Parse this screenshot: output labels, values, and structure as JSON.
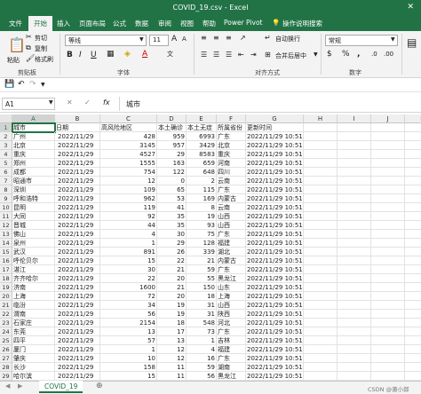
{
  "title": "COVID_19.csv - Excel",
  "tabs": [
    "文件",
    "开始",
    "插入",
    "页面布局",
    "公式",
    "数据",
    "审阅",
    "视图",
    "帮助",
    "Power Pivot",
    "操作说明搜索"
  ],
  "ribbon": {
    "paste": "粘贴",
    "cut": "剪切",
    "copy": "复制",
    "format_painter": "格式刷",
    "clipboard": "剪贴板",
    "font_name": "等线",
    "font_size": "11",
    "font_group": "字体",
    "wrap": "自动换行",
    "merge": "合并后居中",
    "align_group": "对齐方式",
    "number_format": "常规",
    "number_group": "数字",
    "bold": "B",
    "italic": "I",
    "underline": "U",
    "increase_font": "A",
    "decrease_font": "A",
    "font_color": "A",
    "percent": "%",
    "comma": ",",
    "currency": "$"
  },
  "formula": {
    "cell_ref": "A1",
    "value": "城市",
    "fx": "fx",
    "cancel": "✕",
    "enter": "✓"
  },
  "columns": [
    "A",
    "B",
    "C",
    "D",
    "E",
    "F",
    "G",
    "H",
    "I",
    "J",
    "K"
  ],
  "rows": [
    [
      "城市",
      "日期",
      "高风险地区",
      "本土确诊",
      "本土无症",
      "所属省份",
      "更新时间"
    ],
    [
      "广州",
      "2022/11/29",
      "428",
      "959",
      "6993",
      "广东",
      "2022/11/29 10:51"
    ],
    [
      "北京",
      "2022/11/29",
      "3145",
      "957",
      "3429",
      "北京",
      "2022/11/29 10:51"
    ],
    [
      "重庆",
      "2022/11/29",
      "4527",
      "29",
      "8583",
      "重庆",
      "2022/11/29 10:51"
    ],
    [
      "郑州",
      "2022/11/29",
      "1555",
      "163",
      "659",
      "河南",
      "2022/11/29 10:51"
    ],
    [
      "成都",
      "2022/11/29",
      "754",
      "122",
      "648",
      "四川",
      "2022/11/29 10:51"
    ],
    [
      "昭通市",
      "2022/11/29",
      "12",
      "0",
      "2",
      "云南",
      "2022/11/29 10:51"
    ],
    [
      "深圳",
      "2022/11/29",
      "109",
      "65",
      "115",
      "广东",
      "2022/11/29 10:51"
    ],
    [
      "呼和浩特",
      "2022/11/29",
      "962",
      "53",
      "169",
      "内蒙古",
      "2022/11/29 10:51"
    ],
    [
      "昆明",
      "2022/11/29",
      "119",
      "41",
      "8",
      "云南",
      "2022/11/29 10:51"
    ],
    [
      "大同",
      "2022/11/29",
      "92",
      "35",
      "19",
      "山西",
      "2022/11/29 10:51"
    ],
    [
      "晋城",
      "2022/11/29",
      "44",
      "35",
      "93",
      "山西",
      "2022/11/29 10:51"
    ],
    [
      "佛山",
      "2022/11/29",
      "4",
      "30",
      "75",
      "广东",
      "2022/11/29 10:51"
    ],
    [
      "泉州",
      "2022/11/29",
      "1",
      "29",
      "128",
      "福建",
      "2022/11/29 10:51"
    ],
    [
      "武汉",
      "2022/11/29",
      "891",
      "26",
      "339",
      "湖北",
      "2022/11/29 10:51"
    ],
    [
      "呼伦贝尔",
      "2022/11/29",
      "15",
      "22",
      "21",
      "内蒙古",
      "2022/11/29 10:51"
    ],
    [
      "湛江",
      "2022/11/29",
      "30",
      "21",
      "59",
      "广东",
      "2022/11/29 10:51"
    ],
    [
      "齐齐哈尔",
      "2022/11/29",
      "22",
      "20",
      "55",
      "黑龙江",
      "2022/11/29 10:51"
    ],
    [
      "济南",
      "2022/11/29",
      "1600",
      "21",
      "150",
      "山东",
      "2022/11/29 10:51"
    ],
    [
      "上海",
      "2022/11/29",
      "72",
      "20",
      "18",
      "上海",
      "2022/11/29 10:51"
    ],
    [
      "临汾",
      "2022/11/29",
      "34",
      "19",
      "31",
      "山西",
      "2022/11/29 10:51"
    ],
    [
      "渭南",
      "2022/11/29",
      "56",
      "19",
      "31",
      "陕西",
      "2022/11/29 10:51"
    ],
    [
      "石家庄",
      "2022/11/29",
      "2154",
      "18",
      "548",
      "河北",
      "2022/11/29 10:51"
    ],
    [
      "东莞",
      "2022/11/29",
      "13",
      "17",
      "73",
      "广东",
      "2022/11/29 10:51"
    ],
    [
      "四平",
      "2022/11/29",
      "57",
      "13",
      "1",
      "吉林",
      "2022/11/29 10:51"
    ],
    [
      "厦门",
      "2022/11/29",
      "1",
      "12",
      "4",
      "福建",
      "2022/11/29 10:51"
    ],
    [
      "肇庆",
      "2022/11/29",
      "10",
      "12",
      "16",
      "广东",
      "2022/11/29 10:51"
    ],
    [
      "长沙",
      "2022/11/29",
      "158",
      "11",
      "59",
      "湖南",
      "2022/11/29 10:51"
    ],
    [
      "哈尔滨",
      "2022/11/29",
      "15",
      "11",
      "56",
      "黑龙江",
      "2022/11/29 10:51"
    ]
  ],
  "sheet_tab": "COVID_19",
  "watermark": "CSDN @萧小郎"
}
